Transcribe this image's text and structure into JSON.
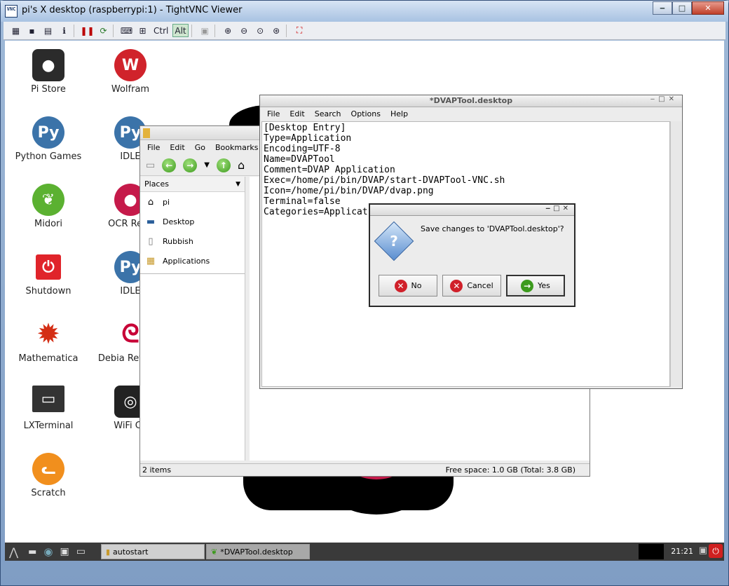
{
  "vnc": {
    "title": "pi's X desktop (raspberrypi:1) - TightVNC Viewer",
    "icon_text": "VNC",
    "toolbar": {
      "ctrl_label": "Ctrl",
      "alt_label": "Alt"
    }
  },
  "desktop_icons": [
    {
      "label": "Pi Store",
      "icon": "raspberry-bag-icon",
      "color": "#2b2b2b"
    },
    {
      "label": "Python Games",
      "icon": "python-icon",
      "color": "#3b73a9"
    },
    {
      "label": "Midori",
      "icon": "midori-leaf-icon",
      "color": "#5bb131"
    },
    {
      "label": "Shutdown",
      "icon": "power-icon",
      "color": "#e0242a"
    },
    {
      "label": "Mathematica",
      "icon": "mathematica-star-icon",
      "color": "#d42e14"
    },
    {
      "label": "LXTerminal",
      "icon": "monitor-icon",
      "color": "#333333"
    },
    {
      "label": "Scratch",
      "icon": "scratch-cat-icon",
      "color": "#f18f1d"
    },
    {
      "label": "Wolfram",
      "icon": "wolf-icon",
      "color": "#d0232b"
    },
    {
      "label": "IDLE",
      "icon": "python-icon",
      "color": "#3b73a9"
    },
    {
      "label": "OCR Reso",
      "icon": "ocr-raspberry-icon",
      "color": "#c51a4a"
    },
    {
      "label": "IDLE",
      "icon": "python-icon",
      "color": "#3b73a9"
    },
    {
      "label": "Debia Referen",
      "icon": "debian-swirl-icon",
      "color": "#c70036"
    },
    {
      "label": "WiFi Co",
      "icon": "wifi-icon",
      "color": "#222222"
    }
  ],
  "file_manager": {
    "menu": [
      "File",
      "Edit",
      "Go",
      "Bookmarks"
    ],
    "places_label": "Places",
    "places": [
      {
        "label": "pi",
        "icon": "home-icon"
      },
      {
        "label": "Desktop",
        "icon": "desktop-icon"
      },
      {
        "label": "Rubbish",
        "icon": "trash-icon"
      },
      {
        "label": "Applications",
        "icon": "applications-icon"
      }
    ],
    "status_left": "2 items",
    "status_right": "Free space: 1.0 GB (Total: 3.8 GB)"
  },
  "editor": {
    "title": "*DVAPTool.desktop",
    "menu": [
      "File",
      "Edit",
      "Search",
      "Options",
      "Help"
    ],
    "lines": [
      "[Desktop Entry]",
      "Type=Application",
      "Encoding=UTF-8",
      "Name=DVAPTool",
      "Comment=DVAP Application",
      "Exec=/home/pi/bin/DVAP/start-DVAPTool-VNC.sh",
      "Icon=/home/pi/bin/DVAP/dvap.png",
      "Terminal=false",
      "Categories=Applicat"
    ]
  },
  "dialog": {
    "message": "Save changes to 'DVAPTool.desktop'?",
    "buttons": {
      "no": "No",
      "cancel": "Cancel",
      "yes": "Yes"
    }
  },
  "taskbar": {
    "tasks": [
      {
        "label": "autostart",
        "icon": "folder-icon"
      },
      {
        "label": "*DVAPTool.desktop",
        "icon": "leafpad-icon"
      }
    ],
    "clock": "21:21"
  }
}
